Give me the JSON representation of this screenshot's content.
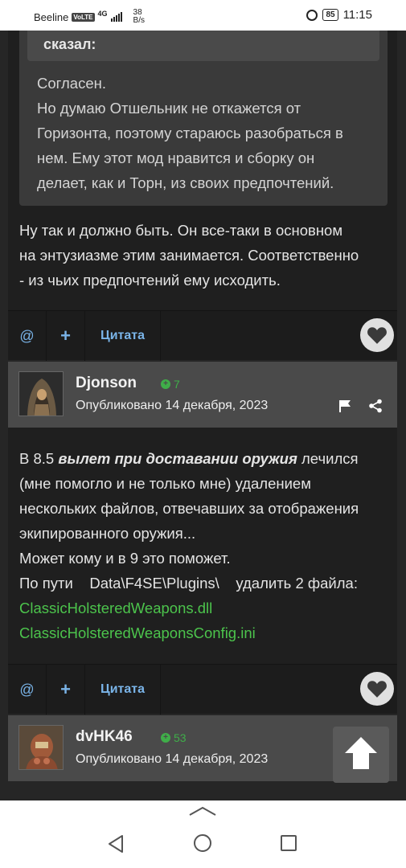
{
  "status_bar": {
    "carrier": "Beeline",
    "volte": "VoLTE",
    "network": "4G",
    "speed_value": "38",
    "speed_unit": "B/s",
    "battery": "85",
    "time": "11:15"
  },
  "quote": {
    "header": "сказал:",
    "lines": [
      "Согласен.",
      "Но думаю Отшельник не откажется от",
      "Горизонта, поэтому стараюсь разобраться в",
      "нем.  Ему этот мод нравится и сборку он",
      "делает, как и Торн, из своих предпочтений."
    ]
  },
  "reply_1": {
    "lines": [
      "Ну так и должно быть.  Он все-таки в основном",
      "на энтузиазме этим занимается. Соответственно",
      "- из чьих предпочтений ему исходить."
    ]
  },
  "actions": {
    "mention": "@",
    "add": "+",
    "quote": "Цитата"
  },
  "post_2": {
    "author": "Djonson",
    "reputation": "7",
    "date": "Опубликовано 14 декабря, 2023",
    "intro_prefix": "В 8.5 ",
    "intro_em": "вылет при доставании оружия",
    "intro_suffix": " лечился",
    "lines": [
      "(мне помогло и не только мне) удалением",
      "нескольких файлов, отвечавших за отображения",
      "экипированного оружия...",
      "Может кому и в 9 это поможет.",
      "По пути    Data\\F4SE\\Plugins\\    удалить 2 файла:"
    ],
    "links": [
      "ClassicHolsteredWeapons.dll",
      "ClassicHolsteredWeaponsConfig.ini"
    ]
  },
  "post_3": {
    "author": "dvHK46",
    "reputation": "53",
    "date": "Опубликовано 14 декабря, 2023"
  },
  "icons": {
    "heart": "heart-icon",
    "flag": "flag-icon",
    "share": "share-icon",
    "scroll_top": "arrow-up-icon"
  }
}
